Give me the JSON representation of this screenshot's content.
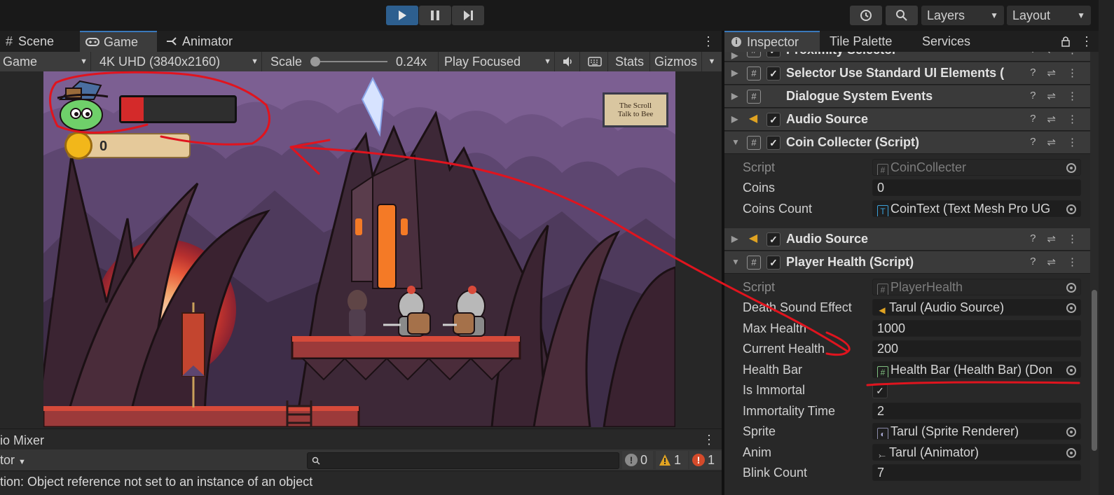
{
  "toolbar": {
    "layers_label": "Layers",
    "layout_label": "Layout"
  },
  "left_tabs": [
    {
      "label": "Scene"
    },
    {
      "label": "Game"
    },
    {
      "label": "Animator"
    }
  ],
  "right_tabs": [
    {
      "label": "Inspector"
    },
    {
      "label": "Tile Palette"
    },
    {
      "label": "Services"
    }
  ],
  "game_bar": {
    "display": "Game",
    "resolution": "4K UHD (3840x2160)",
    "scale_label": "Scale",
    "scale_value": "0.24x",
    "scale_fraction": 0.0,
    "play_mode": "Play Focused",
    "stats_label": "Stats",
    "gizmos_label": "Gizmos"
  },
  "game_hud": {
    "coin_count": "0",
    "health_fraction": 0.2,
    "scroll_line1": "The Scroll",
    "scroll_line2": "Talk to Bee"
  },
  "bottom": {
    "panel_title": "io Mixer",
    "dropdown_label": "tor",
    "count_info": "0",
    "count_warn": "1",
    "count_error": "1",
    "status_message": "tion: Object reference not set to an instance of an object"
  },
  "inspector": {
    "components": [
      {
        "title": "Proximity Selector",
        "icon": "script",
        "checked": true
      },
      {
        "title": "Selector Use Standard UI Elements (",
        "icon": "script",
        "checked": true
      },
      {
        "title": "Dialogue System Events",
        "icon": "script",
        "checked": false
      },
      {
        "title": "Audio Source",
        "icon": "audio",
        "checked": true
      },
      {
        "title": "Coin Collecter (Script)",
        "icon": "script",
        "checked": true
      },
      {
        "title": "Audio Source",
        "icon": "audio",
        "checked": true
      },
      {
        "title": "Player Health (Script)",
        "icon": "script",
        "checked": true
      }
    ],
    "coin_props": [
      {
        "label": "Script",
        "value": "CoinCollecter"
      },
      {
        "label": "Coins",
        "value": "0"
      },
      {
        "label": "Coins Count",
        "value": "CoinText (Text Mesh Pro UG"
      }
    ],
    "health_props": [
      {
        "label": "Script",
        "value": "PlayerHealth"
      },
      {
        "label": "Death Sound Effect",
        "value": "Tarul (Audio Source)"
      },
      {
        "label": "Max Health",
        "value": "1000"
      },
      {
        "label": "Current Health",
        "value": "200"
      },
      {
        "label": "Health Bar",
        "value": "Health Bar (Health Bar) (Don"
      },
      {
        "label": "Is Immortal",
        "value": ""
      },
      {
        "label": "Immortality Time",
        "value": "2"
      },
      {
        "label": "Sprite",
        "value": "Tarul (Sprite Renderer)"
      },
      {
        "label": "Anim",
        "value": "Tarul (Animator)"
      },
      {
        "label": "Blink Count",
        "value": "7"
      }
    ]
  },
  "colors": {
    "accent": "#3a79bb",
    "annotation": "#e0141e",
    "warning": "#e0a322",
    "error": "#d44a2a"
  }
}
